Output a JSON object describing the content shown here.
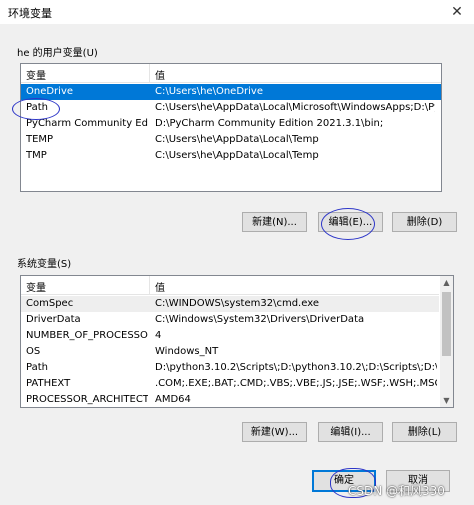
{
  "window": {
    "title": "环境变量",
    "close_glyph": "✕"
  },
  "user_section": {
    "label": "he 的用户变量(U)",
    "columns": [
      "变量",
      "值"
    ],
    "rows": [
      {
        "name": "OneDrive",
        "value": "C:\\Users\\he\\OneDrive"
      },
      {
        "name": "Path",
        "value": "C:\\Users\\he\\AppData\\Local\\Microsoft\\WindowsApps;D:\\PyCh..."
      },
      {
        "name": "PyCharm Community Editi...",
        "value": "D:\\PyCharm Community Edition 2021.3.1\\bin;"
      },
      {
        "name": "TEMP",
        "value": "C:\\Users\\he\\AppData\\Local\\Temp"
      },
      {
        "name": "TMP",
        "value": "C:\\Users\\he\\AppData\\Local\\Temp"
      }
    ],
    "buttons": {
      "new": "新建(N)...",
      "edit": "编辑(E)...",
      "delete": "删除(D)"
    }
  },
  "system_section": {
    "label": "系统变量(S)",
    "columns": [
      "变量",
      "值"
    ],
    "rows": [
      {
        "name": "ComSpec",
        "value": "C:\\WINDOWS\\system32\\cmd.exe"
      },
      {
        "name": "DriverData",
        "value": "C:\\Windows\\System32\\Drivers\\DriverData"
      },
      {
        "name": "NUMBER_OF_PROCESSORS",
        "value": "4"
      },
      {
        "name": "OS",
        "value": "Windows_NT"
      },
      {
        "name": "Path",
        "value": "D:\\python3.10.2\\Scripts\\;D:\\python3.10.2\\;D:\\Scripts\\;D:\\C:\\W..."
      },
      {
        "name": "PATHEXT",
        "value": ".COM;.EXE;.BAT;.CMD;.VBS;.VBE;.JS;.JSE;.WSF;.WSH;.MSC;.PY;.P..."
      },
      {
        "name": "PROCESSOR_ARCHITECT...",
        "value": "AMD64"
      }
    ],
    "buttons": {
      "new": "新建(W)...",
      "edit": "编辑(I)...",
      "delete": "删除(L)"
    }
  },
  "footer": {
    "ok": "确定",
    "cancel": "取消"
  },
  "watermark": "CSDN @和风330",
  "colors": {
    "selection": "#0078d7",
    "annotation": "#2d36c8"
  }
}
